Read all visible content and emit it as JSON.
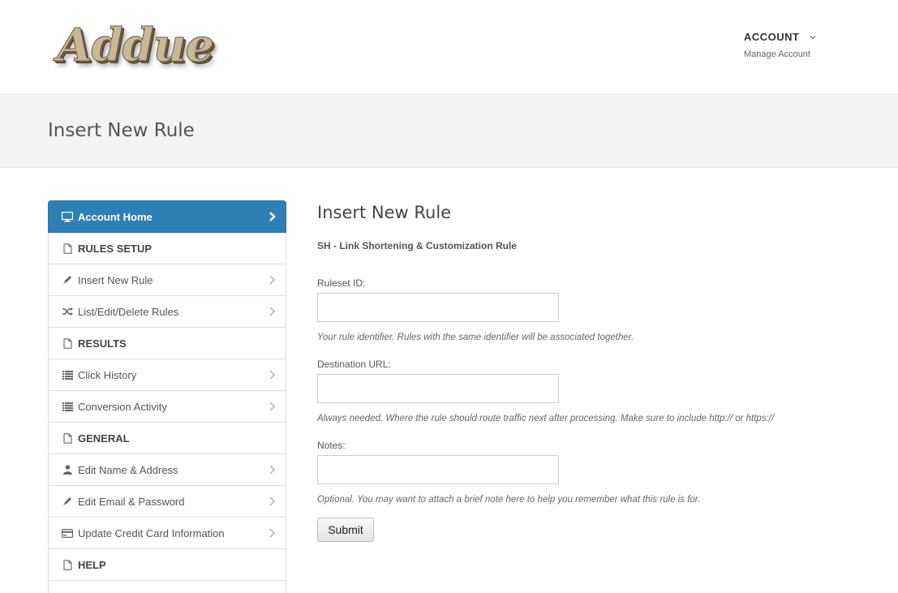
{
  "header": {
    "logo_text": "Addue",
    "account_title": "ACCOUNT",
    "account_subtitle": "Manage Account"
  },
  "page_title": "Insert New Rule",
  "sidebar": {
    "items": [
      {
        "label": "Account Home",
        "icon": "monitor-icon",
        "kind": "active"
      },
      {
        "label": "RULES SETUP",
        "icon": "document-icon",
        "kind": "section"
      },
      {
        "label": "Insert New Rule",
        "icon": "pencil-icon",
        "kind": "link"
      },
      {
        "label": "List/Edit/Delete Rules",
        "icon": "shuffle-icon",
        "kind": "link"
      },
      {
        "label": "RESULTS",
        "icon": "document-icon",
        "kind": "section"
      },
      {
        "label": "Click History",
        "icon": "list-icon",
        "kind": "link"
      },
      {
        "label": "Conversion Activity",
        "icon": "list-icon",
        "kind": "link"
      },
      {
        "label": "GENERAL",
        "icon": "document-icon",
        "kind": "section"
      },
      {
        "label": "Edit Name & Address",
        "icon": "user-icon",
        "kind": "link"
      },
      {
        "label": "Edit Email & Password",
        "icon": "pencil-icon",
        "kind": "link"
      },
      {
        "label": "Update Credit Card Information",
        "icon": "credit-card-icon",
        "kind": "link"
      },
      {
        "label": "HELP",
        "icon": "document-icon",
        "kind": "section"
      }
    ]
  },
  "form": {
    "heading": "Insert New Rule",
    "rule_type": "SH - Link Shortening & Customization Rule",
    "fields": [
      {
        "label": "Ruleset ID:",
        "value": "",
        "help": "Your rule identifier. Rules with the same identifier will be associated together."
      },
      {
        "label": "Destination URL:",
        "value": "",
        "help": "Always needed. Where the rule should route traffic next after processing. Make sure to include http:// or https://"
      },
      {
        "label": "Notes:",
        "value": "",
        "help": "Optional. You may want to attach a brief note here to help you remember what this rule is for."
      }
    ],
    "submit_label": "Submit"
  },
  "colors": {
    "accent": "#2d7fb6",
    "title_band": "#f3f3f3"
  }
}
